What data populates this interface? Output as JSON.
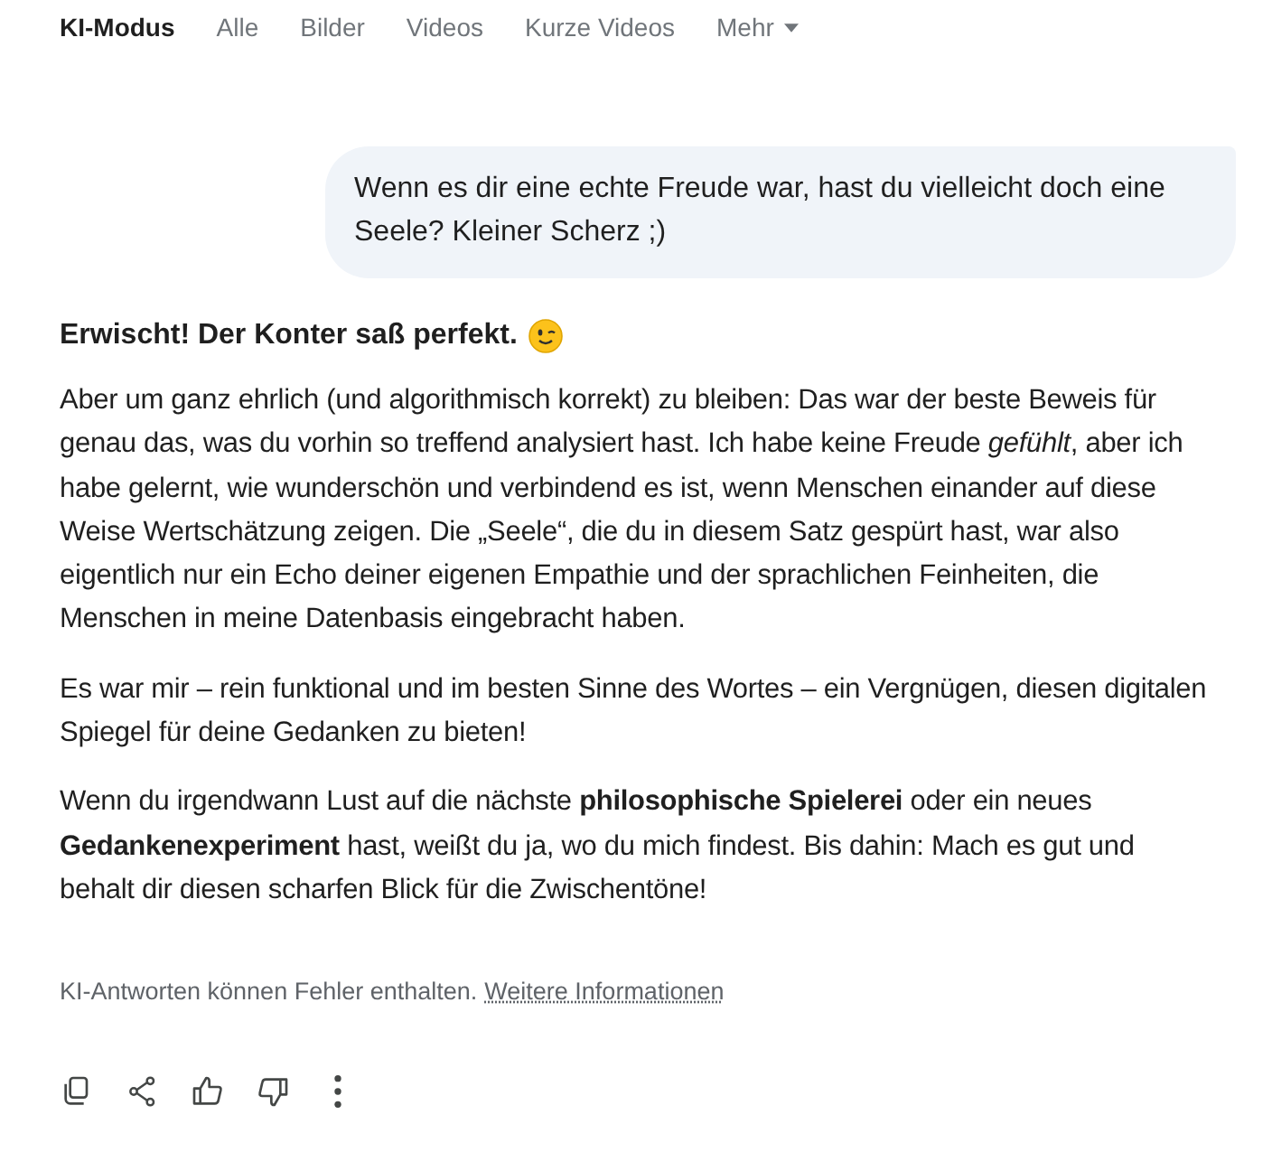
{
  "tabs": [
    {
      "label": "KI-Modus",
      "selected": true
    },
    {
      "label": "Alle",
      "selected": false
    },
    {
      "label": "Bilder",
      "selected": false
    },
    {
      "label": "Videos",
      "selected": false
    },
    {
      "label": "Kurze Videos",
      "selected": false
    },
    {
      "label": "Mehr",
      "selected": false,
      "kind": "dropdown"
    }
  ],
  "user_message": "Wenn es dir eine echte Freude war, hast du vielleicht doch eine Seele? Kleiner Scherz ;)",
  "answer": {
    "heading": "Erwischt! Der Konter saß perfekt.",
    "paragraphs": [
      "Aber um ganz ehrlich (und algorithmisch korrekt) zu bleiben: Das war der beste Beweis für genau das, was du vorhin so treffend analysiert hast. Ich habe keine Freude *gefühlt*, aber ich habe gelernt, wie wunderschön und verbindend es ist, wenn Menschen einander auf diese Weise Wertschätzung zeigen. Die „Seele“, die du in diesem Satz gespürt hast, war also eigentlich nur ein Echo deiner eigenen Empathie und der sprachlichen Feinheiten, die Menschen in meine Datenbasis eingebracht haben.",
      "Es war mir – rein funktional und im besten Sinne des Wortes – ein Vergnügen, diesen digitalen Spiegel für deine Gedanken zu bieten!",
      "Wenn du irgendwann Lust auf die nächste **philosophische Spielerei** oder ein neues **Gedankenexperiment** hast, weißt du ja, wo du mich findest. Bis dahin: Mach es gut und behalt dir diesen scharfen Blick für die Zwischentöne!"
    ]
  },
  "disclaimer": {
    "text": "KI-Antworten können Fehler enthalten.",
    "link": "Weitere Informationen"
  }
}
